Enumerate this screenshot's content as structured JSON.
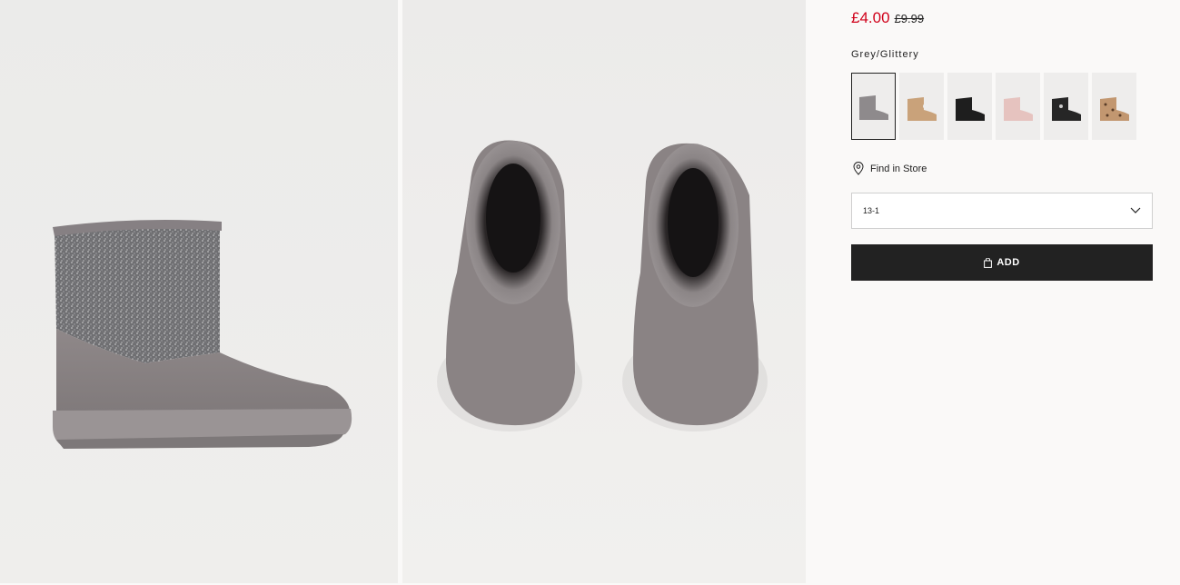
{
  "product": {
    "price_now": "£4.00",
    "price_was": "£9.99",
    "color_name": "Grey/Glittery"
  },
  "swatches": [
    {
      "name": "grey-glitter",
      "color": "#8e8a8c",
      "active": true
    },
    {
      "name": "camel",
      "color": "#c9a27a"
    },
    {
      "name": "black",
      "color": "#1e1e1e"
    },
    {
      "name": "pink",
      "color": "#e6c3bf"
    },
    {
      "name": "black-bow",
      "color": "#262626"
    },
    {
      "name": "leopard",
      "color": "#c29770"
    }
  ],
  "find_in_store": {
    "label": "Find in Store",
    "icon": "location-pin-icon"
  },
  "size_select": {
    "value": "13-1",
    "icon": "chevron-down-icon"
  },
  "add_button": {
    "label": "ADD",
    "icon": "shopping-bag-icon"
  },
  "images": [
    {
      "name": "boot-side-view"
    },
    {
      "name": "boots-top-view"
    }
  ]
}
